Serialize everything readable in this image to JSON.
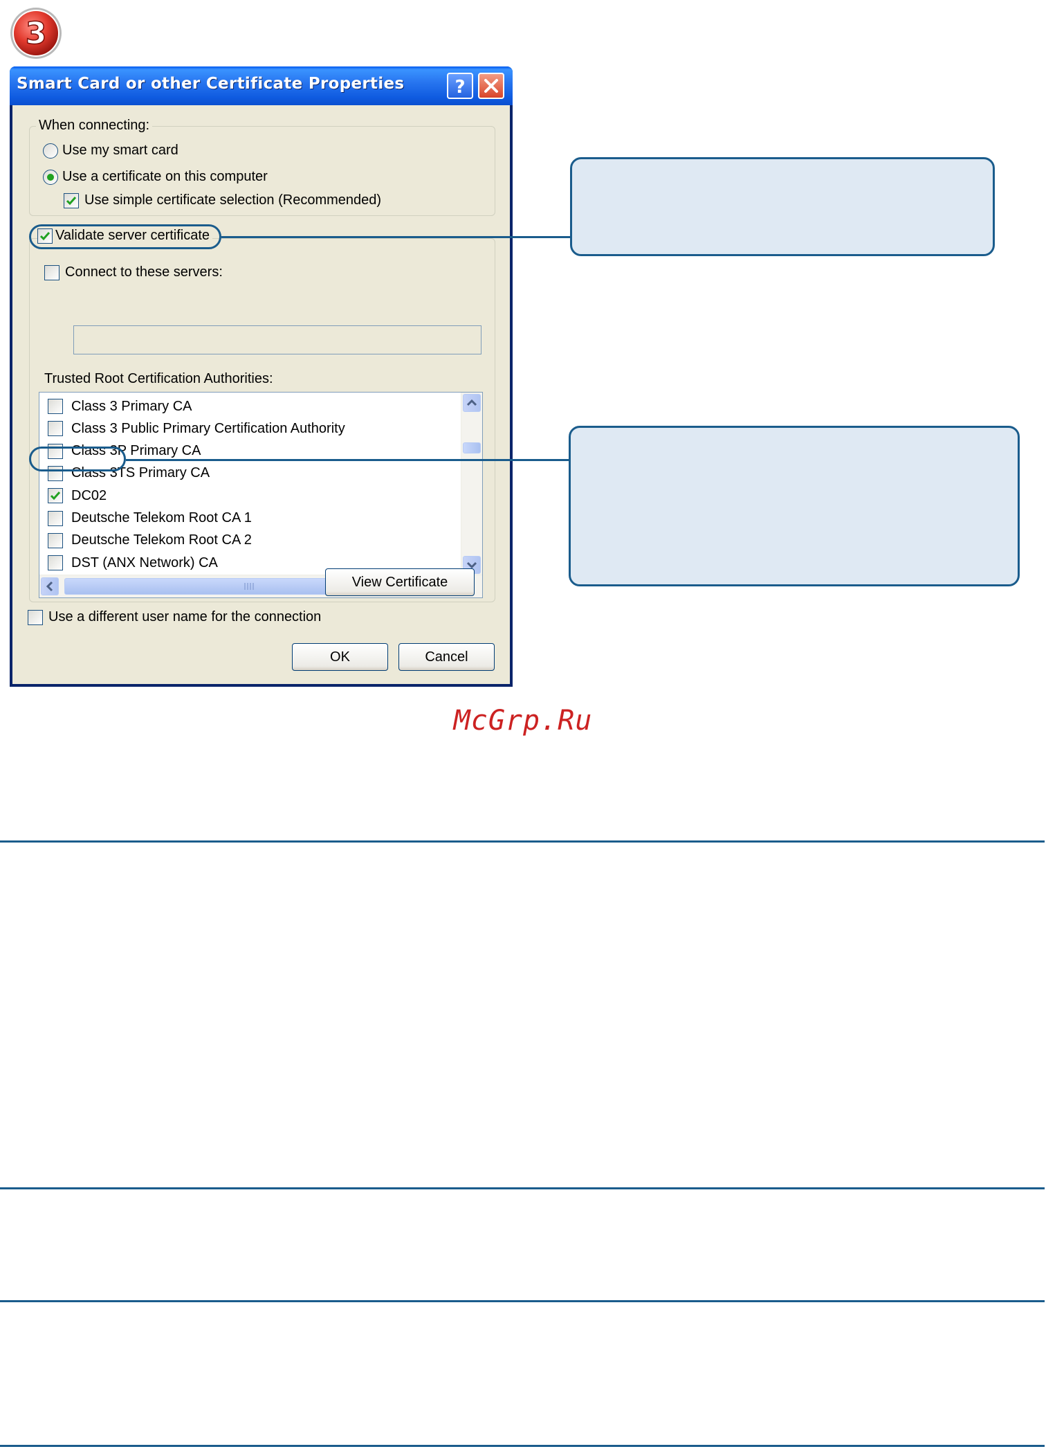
{
  "step": {
    "number": "3"
  },
  "dialog": {
    "title": "Smart Card or other Certificate Properties",
    "help_label": "?",
    "when_connecting": {
      "label": "When connecting:",
      "use_smart_card": {
        "label": "Use my smart card",
        "selected": false
      },
      "use_certificate": {
        "label": "Use a certificate on this computer",
        "selected": true
      },
      "simple_selection": {
        "label": "Use simple certificate selection (Recommended)",
        "checked": true
      }
    },
    "validate_server_certificate": {
      "label": "Validate server certificate",
      "checked": true
    },
    "connect_to_servers": {
      "label": "Connect to these servers:",
      "checked": false,
      "value": ""
    },
    "trusted_roots": {
      "label": "Trusted Root Certification Authorities:",
      "items": [
        {
          "label": "Class 3 Primary CA",
          "checked": false
        },
        {
          "label": "Class 3 Public Primary Certification Authority",
          "checked": false
        },
        {
          "label": "Class 3P Primary CA",
          "checked": false
        },
        {
          "label": "Class 3TS Primary CA",
          "checked": false
        },
        {
          "label": "DC02",
          "checked": true
        },
        {
          "label": "Deutsche Telekom Root CA 1",
          "checked": false
        },
        {
          "label": "Deutsche Telekom Root CA 2",
          "checked": false
        },
        {
          "label": "DST (ANX Network) CA",
          "checked": false
        }
      ]
    },
    "view_certificate_label": "View Certificate",
    "different_user_name": {
      "label": "Use a different user name for the connection",
      "checked": false
    },
    "ok_label": "OK",
    "cancel_label": "Cancel"
  },
  "watermark": "McGrp.Ru",
  "colors": {
    "annotation": "#1a5c8c",
    "callout_fill": "#dfe9f3",
    "dialog_face": "#ece9d8",
    "titlebar": "#2876f0",
    "watermark": "#cc2222"
  }
}
